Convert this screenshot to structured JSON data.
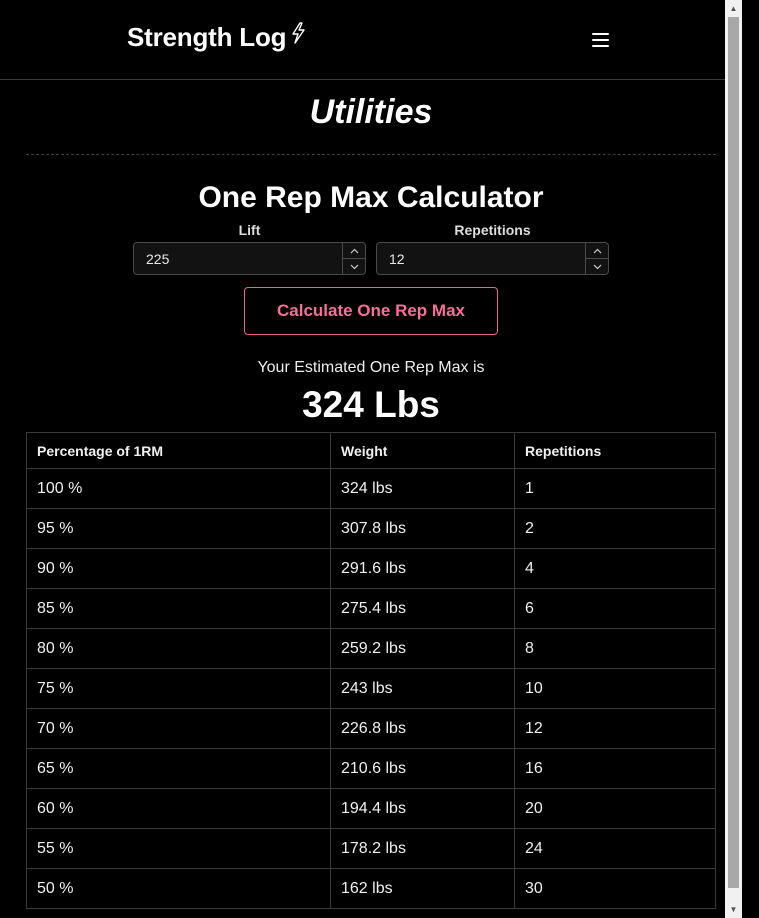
{
  "header": {
    "brand": "Strength Log",
    "brand_icon": "lightning-bolt-icon",
    "menu_icon": "hamburger-menu-icon"
  },
  "page": {
    "title": "Utilities"
  },
  "calculator": {
    "title": "One Rep Max Calculator",
    "lift_label": "Lift",
    "lift_value": "225",
    "reps_label": "Repetitions",
    "reps_value": "12",
    "button_label": "Calculate One Rep Max",
    "result_label": "Your Estimated One Rep Max is",
    "result_value": "324 Lbs",
    "accent_color": "#f06090"
  },
  "table": {
    "headers": [
      "Percentage of 1RM",
      "Weight",
      "Repetitions"
    ],
    "rows": [
      [
        "100 %",
        "324 lbs",
        "1"
      ],
      [
        "95 %",
        "307.8 lbs",
        "2"
      ],
      [
        "90 %",
        "291.6 lbs",
        "4"
      ],
      [
        "85 %",
        "275.4 lbs",
        "6"
      ],
      [
        "80 %",
        "259.2 lbs",
        "8"
      ],
      [
        "75 %",
        "243 lbs",
        "10"
      ],
      [
        "70 %",
        "226.8 lbs",
        "12"
      ],
      [
        "65 %",
        "210.6 lbs",
        "16"
      ],
      [
        "60 %",
        "194.4 lbs",
        "20"
      ],
      [
        "55 %",
        "178.2 lbs",
        "24"
      ],
      [
        "50 %",
        "162 lbs",
        "30"
      ]
    ]
  }
}
